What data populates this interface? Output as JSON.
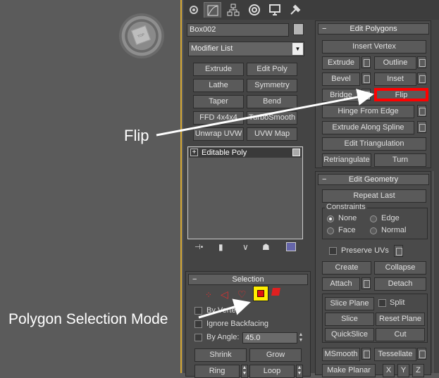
{
  "object_name": "Box002",
  "modifier_list": {
    "label": "Modifier List"
  },
  "modifier_buttons": [
    "Extrude",
    "Edit Poly",
    "Lathe",
    "Symmetry",
    "Taper",
    "Bend",
    "FFD 4x4x4",
    "TurboSmooth",
    "Unwrap UVW",
    "UVW Map"
  ],
  "stack_item": "Editable Poly",
  "selection": {
    "title": "Selection",
    "by_vertex": "By Vertex",
    "ignore_backfacing": "Ignore Backfacing",
    "by_angle": "By Angle:",
    "angle_value": "45.0",
    "shrink": "Shrink",
    "grow": "Grow",
    "ring": "Ring",
    "loop": "Loop"
  },
  "edit_polygons": {
    "title": "Edit Polygons",
    "insert_vertex": "Insert Vertex",
    "extrude": "Extrude",
    "outline": "Outline",
    "bevel": "Bevel",
    "inset": "Inset",
    "bridge": "Bridge",
    "flip": "Flip",
    "hinge_from_edge": "Hinge From Edge",
    "extrude_along_spline": "Extrude Along Spline",
    "edit_triangulation": "Edit Triangulation",
    "retriangulate": "Retriangulate",
    "turn": "Turn"
  },
  "edit_geometry": {
    "title": "Edit Geometry",
    "repeat_last": "Repeat Last",
    "constraints_label": "Constraints",
    "none": "None",
    "edge": "Edge",
    "face": "Face",
    "normal": "Normal",
    "preserve_uvs": "Preserve UVs",
    "create": "Create",
    "collapse": "Collapse",
    "attach": "Attach",
    "detach": "Detach",
    "slice_plane": "Slice Plane",
    "split": "Split",
    "slice": "Slice",
    "reset_plane": "Reset Plane",
    "quickslice": "QuickSlice",
    "cut": "Cut",
    "msmooth": "MSmooth",
    "tessellate": "Tessellate",
    "make_planar": "Make Planar",
    "x": "X",
    "y": "Y",
    "z": "Z"
  },
  "annotations": {
    "flip": "Flip",
    "polygon_selection_mode": "Polygon Selection Mode"
  },
  "colors": {
    "highlight_red": "#ff0000",
    "selected_yellow": "#ffee00",
    "frame_gold": "#d6a934"
  },
  "icons": [
    "create-tab-icon",
    "modify-tab-icon",
    "hierarchy-tab-icon",
    "motion-tab-icon",
    "display-tab-icon",
    "utilities-tab-icon"
  ]
}
